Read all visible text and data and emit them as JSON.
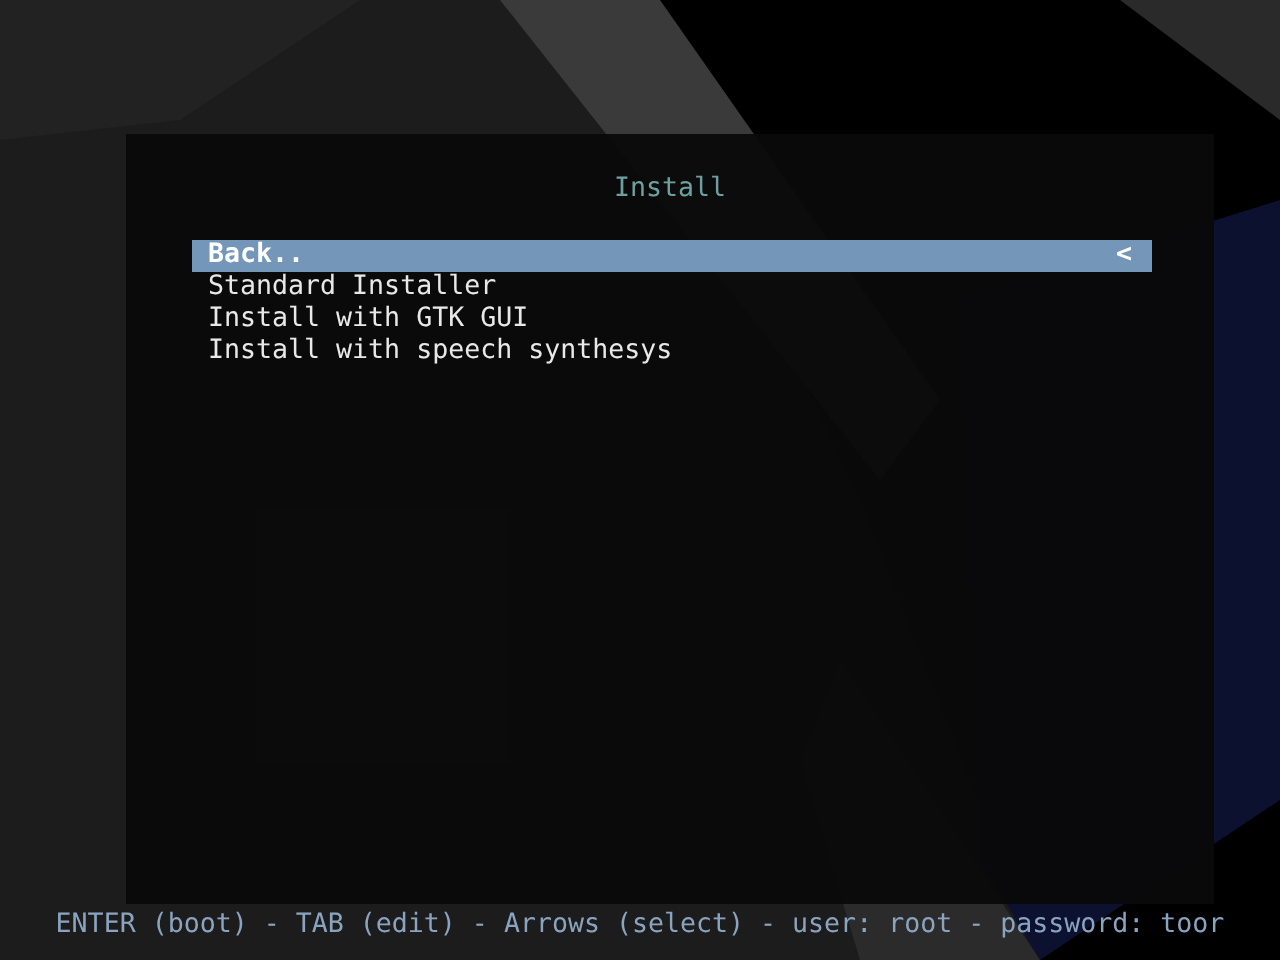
{
  "menu": {
    "title": "Install",
    "selection_marker": "<",
    "items": [
      {
        "label": "Back..",
        "selected": true
      },
      {
        "label": "Standard Installer",
        "selected": false
      },
      {
        "label": "Install with GTK GUI",
        "selected": false
      },
      {
        "label": "Install with speech synthesys",
        "selected": false
      }
    ]
  },
  "help_line": "ENTER (boot) - TAB (edit) - Arrows (select) - user: root - password: toor"
}
